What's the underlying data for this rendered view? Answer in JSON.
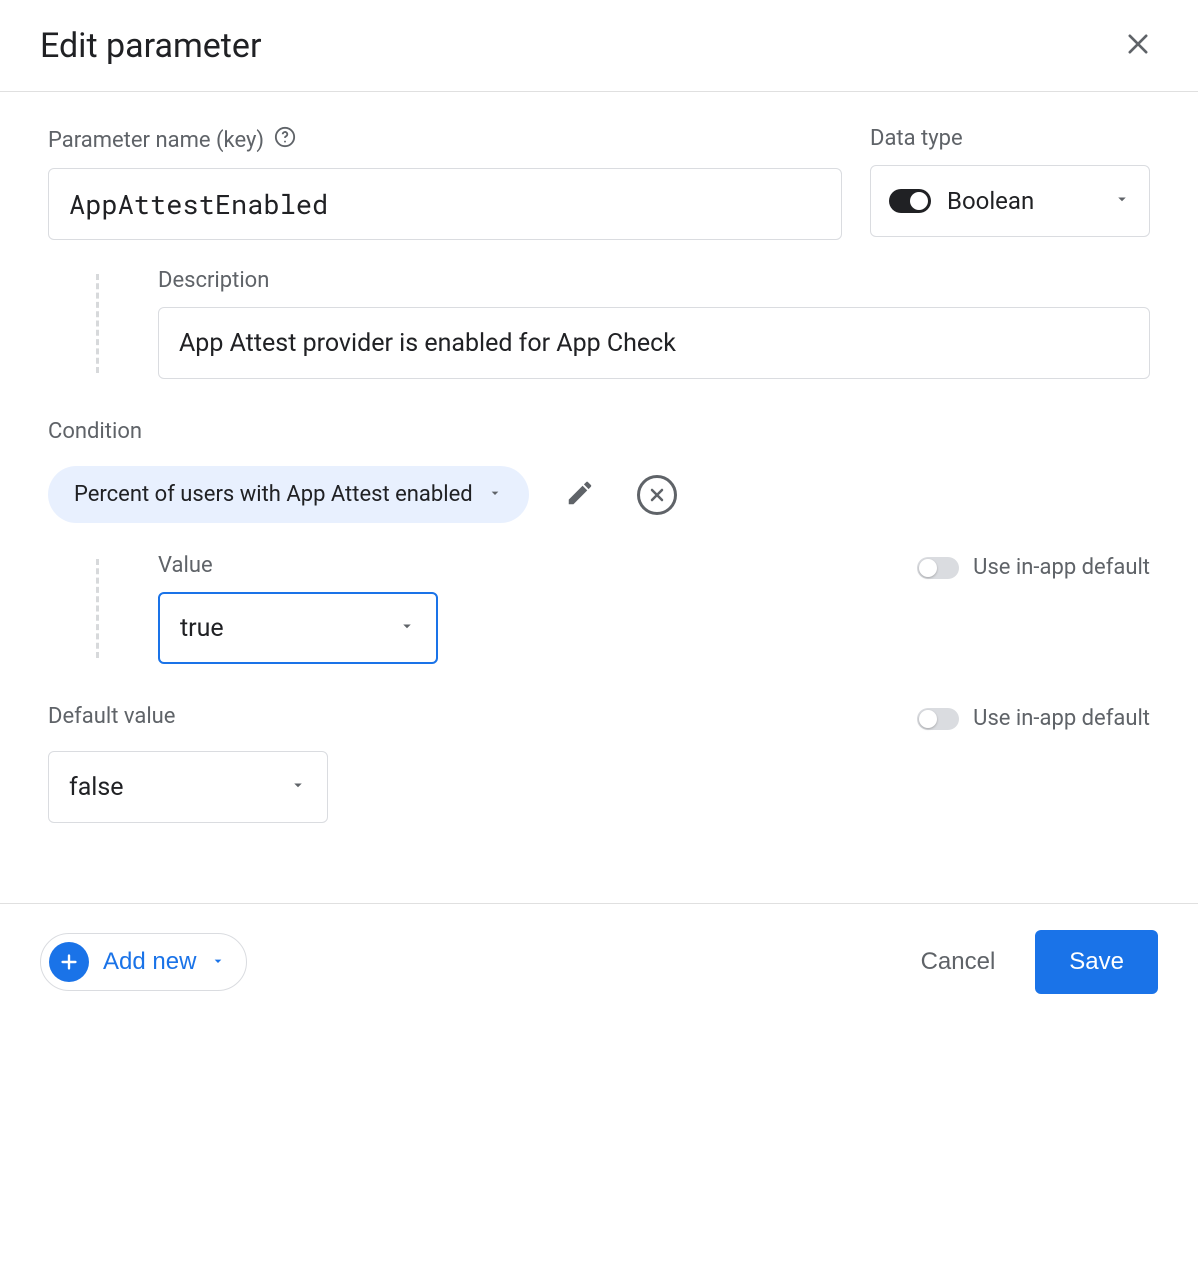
{
  "header": {
    "title": "Edit parameter"
  },
  "param": {
    "name_label": "Parameter name (key)",
    "name_value": "AppAttestEnabled",
    "type_label": "Data type",
    "type_value": "Boolean",
    "description_label": "Description",
    "description_value": "App Attest provider is enabled for App Check"
  },
  "condition": {
    "label": "Condition",
    "chip": "Percent of users with App Attest enabled",
    "value_label": "Value",
    "value": "true",
    "use_default_label": "Use in-app default"
  },
  "default": {
    "label": "Default value",
    "value": "false",
    "use_default_label": "Use in-app default"
  },
  "footer": {
    "add_new": "Add new",
    "cancel": "Cancel",
    "save": "Save"
  }
}
